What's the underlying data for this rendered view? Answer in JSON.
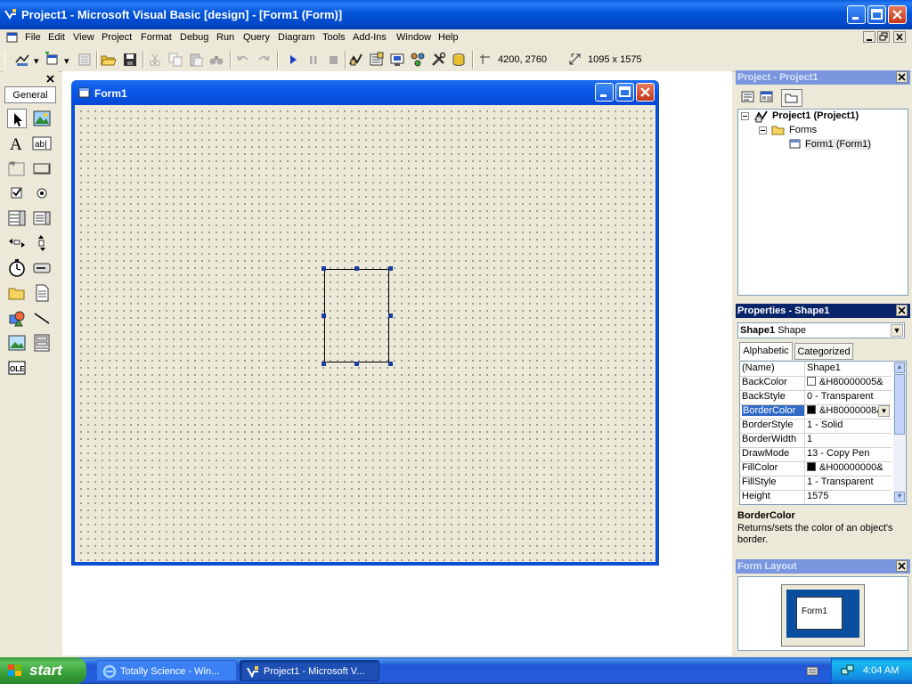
{
  "window": {
    "title": "Project1 - Microsoft Visual Basic [design] - [Form1 (Form)]",
    "icon": "vb-icon"
  },
  "menu": [
    "File",
    "Edit",
    "View",
    "Project",
    "Format",
    "Debug",
    "Run",
    "Query",
    "Diagram",
    "Tools",
    "Add-Ins",
    "Window",
    "Help"
  ],
  "toolbar": {
    "position_readout": "4200, 2760",
    "size_readout": "1095 x 1575"
  },
  "toolbox": {
    "tab_label": "General",
    "tools": [
      "pointer",
      "picturebox",
      "label",
      "textbox",
      "frame",
      "commandbutton",
      "checkbox",
      "optionbutton",
      "combobox",
      "listbox",
      "hscrollbar",
      "vscrollbar",
      "timer",
      "drivelistbox",
      "dirlistbox",
      "filelistbox",
      "shape",
      "line",
      "image",
      "data",
      "ole"
    ]
  },
  "form_window": {
    "title": "Form1"
  },
  "project_pane": {
    "title": "Project - Project1",
    "tree": {
      "root": "Project1 (Project1)",
      "folder": "Forms",
      "leaf": "Form1 (Form1)"
    }
  },
  "properties_pane": {
    "title": "Properties - Shape1",
    "object_name": "Shape1",
    "object_type": "Shape",
    "tabs": [
      "Alphabetic",
      "Categorized"
    ],
    "rows": [
      {
        "name": "(Name)",
        "value": "Shape1"
      },
      {
        "name": "BackColor",
        "value": "&H80000005&",
        "swatch": "#ffffff"
      },
      {
        "name": "BackStyle",
        "value": "0 - Transparent"
      },
      {
        "name": "BorderColor",
        "value": "&H80000008&",
        "swatch": "#000000",
        "selected": true
      },
      {
        "name": "BorderStyle",
        "value": "1 - Solid"
      },
      {
        "name": "BorderWidth",
        "value": "1"
      },
      {
        "name": "DrawMode",
        "value": "13 - Copy Pen"
      },
      {
        "name": "FillColor",
        "value": "&H00000000&",
        "swatch": "#000000"
      },
      {
        "name": "FillStyle",
        "value": "1 - Transparent"
      },
      {
        "name": "Height",
        "value": "1575"
      }
    ],
    "description_title": "BorderColor",
    "description_text": "Returns/sets the color of an object's border."
  },
  "layout_pane": {
    "title": "Form Layout",
    "preview_label": "Form1"
  },
  "taskbar": {
    "start_label": "start",
    "tasks": [
      "Totally Science - Win...",
      "Project1 - Microsoft V..."
    ],
    "clock": "4:04 AM"
  },
  "colors": {
    "title_blue": "#0054e3",
    "pane_active": "#0a246a",
    "selection": "#316ac5",
    "start_green": "#3c9a3c"
  }
}
